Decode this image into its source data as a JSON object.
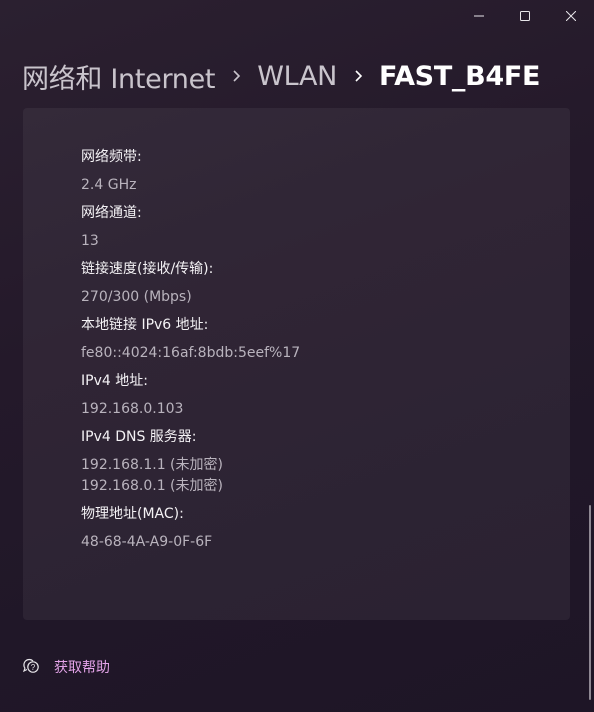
{
  "window": {
    "controls": [
      "minimize",
      "maximize",
      "close"
    ]
  },
  "breadcrumb": {
    "items": [
      "网络和 Internet",
      "WLAN",
      "FAST_B4FE"
    ]
  },
  "properties": {
    "band_label": "网络频带:",
    "band_value": "2.4 GHz",
    "channel_label": "网络通道:",
    "channel_value": "13",
    "speed_label": "链接速度(接收/传输):",
    "speed_value": "270/300 (Mbps)",
    "ipv6_label": "本地链接 IPv6 地址:",
    "ipv6_value": "fe80::4024:16af:8bdb:5eef%17",
    "ipv4_label": "IPv4 地址:",
    "ipv4_value": "192.168.0.103",
    "dns_label": "IPv4 DNS 服务器:",
    "dns_values": [
      "192.168.1.1 (未加密)",
      "192.168.0.1 (未加密)"
    ],
    "mac_label": "物理地址(MAC):",
    "mac_value": "48-68-4A-A9-0F-6F"
  },
  "help": {
    "label": "获取帮助",
    "icon": "help-chat-icon"
  },
  "colors": {
    "accent": "#e3a3e8",
    "background": "#231a2a",
    "card": "#2f2735"
  }
}
